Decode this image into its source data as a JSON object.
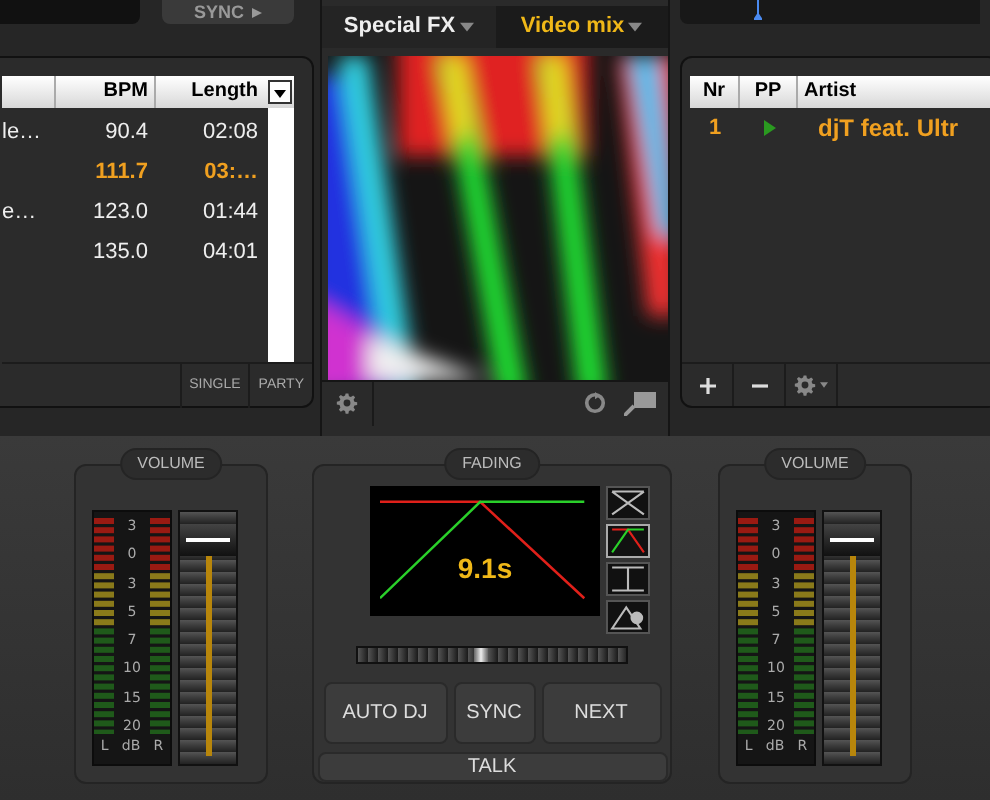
{
  "left_deck": {
    "sync_button": "SYNC",
    "table": {
      "columns": [
        "BPM",
        "Length"
      ],
      "rows": [
        {
          "column_1": "le…",
          "bpm": "90.4",
          "length": "02:08",
          "playing": false
        },
        {
          "bpm": "111.7",
          "length": "03:…",
          "playing": true
        },
        {
          "column_1": "e…",
          "bpm": "123.0",
          "length": "01:44",
          "playing": false
        },
        {
          "bpm": "135.0",
          "length": "04:01",
          "playing": false
        }
      ]
    },
    "buttons": [
      "SINGLE",
      "PARTY"
    ]
  },
  "center": {
    "tabs": [
      {
        "label": "Special FX",
        "selected": false
      },
      {
        "label": "Video mix",
        "selected": true
      }
    ]
  },
  "playlist": {
    "columns": [
      "Nr",
      "PP",
      "Artist"
    ],
    "rows": [
      {
        "nr": "1",
        "artist": "djT feat. Ultr",
        "playing": true
      }
    ]
  },
  "volume_left": {
    "title": "VOLUME",
    "scale": [
      "3",
      "0",
      "3",
      "5",
      "7",
      "10",
      "15",
      "20"
    ],
    "channels": [
      "L",
      "dB",
      "R"
    ],
    "level": 0.95
  },
  "fading": {
    "title": "FADING",
    "time": "9.1s",
    "modes": [
      {
        "kind": "cross",
        "selected": false
      },
      {
        "kind": "curve",
        "selected": true
      },
      {
        "kind": "cut",
        "selected": false
      },
      {
        "kind": "manual",
        "selected": false
      }
    ],
    "crossfader": {
      "level": 0.45
    },
    "buttons": [
      "AUTO DJ",
      "SYNC",
      "NEXT"
    ],
    "talk_button": "TALK"
  },
  "volume_right": {
    "title": "VOLUME",
    "scale": [
      "3",
      "0",
      "3",
      "5",
      "7",
      "10",
      "15",
      "20"
    ],
    "channels": [
      "L",
      "dB",
      "R"
    ],
    "level": 0.95
  }
}
